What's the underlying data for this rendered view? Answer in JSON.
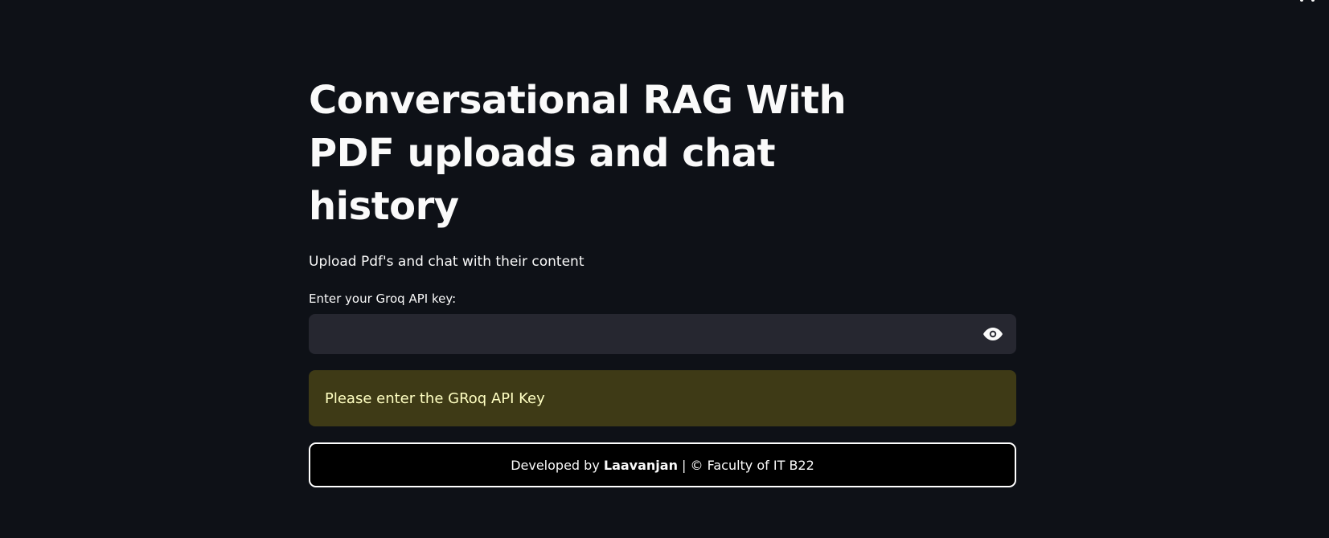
{
  "app": {
    "title": "Conversational RAG With PDF uploads and chat history",
    "subtitle": "Upload Pdf's and chat with their content"
  },
  "api_key_field": {
    "label": "Enter your Groq API key:",
    "value": "",
    "placeholder": "",
    "toggle_icon": "eye-icon"
  },
  "warning": {
    "text": "Please enter the GRoq API Key",
    "background": "#3e3a16",
    "text_color": "#ffffc2"
  },
  "footer": {
    "prefix": "Developed by ",
    "author": "Laavanjan",
    "suffix": " | © Faculty of IT B22"
  },
  "theme": {
    "background": "#0e1117",
    "input_background": "#262730"
  }
}
